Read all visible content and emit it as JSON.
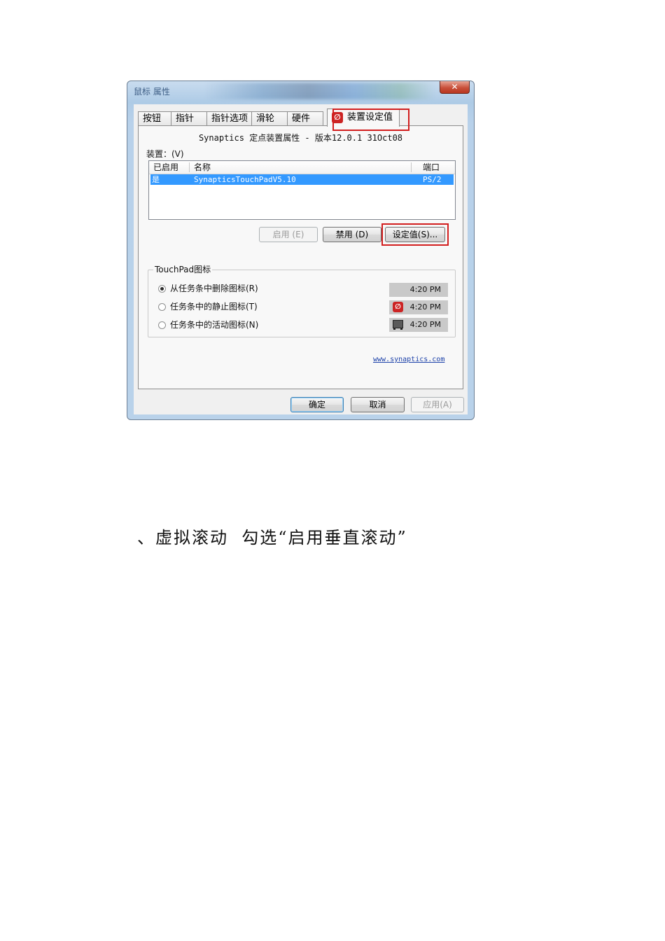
{
  "window": {
    "title": "鼠标 属性",
    "close_glyph": "✕"
  },
  "tabs": [
    "按钮",
    "指针",
    "指针选项",
    "滑轮",
    "硬件",
    "装置设定值"
  ],
  "tab_icon_glyph": "∅",
  "panel": {
    "version_text": "Synaptics 定点装置属性 - 版本12.0.1 31Oct08",
    "device_label": "装置：(V)",
    "columns": [
      "已启用",
      "名称",
      "端口"
    ],
    "rows": [
      {
        "enabled": "是",
        "name": "SynapticsTouchPadV5.10",
        "port": "PS/2"
      }
    ],
    "buttons": {
      "enable": "启用 (E)",
      "disable": "禁用 (D)",
      "settings": "设定值(S)..."
    },
    "group_title": "TouchPad图标",
    "radios": [
      {
        "label": "从任务条中删除图标(R)",
        "checked": true,
        "time": "4:20 PM",
        "icon": "none"
      },
      {
        "label": "任务条中的静止图标(T)",
        "checked": false,
        "time": "4:20 PM",
        "icon": "synaptics-icon"
      },
      {
        "label": "任务条中的活动图标(N)",
        "checked": false,
        "time": "4:20 PM",
        "icon": "touchpad-icon"
      }
    ],
    "link": "www.synaptics.com"
  },
  "footer": {
    "ok": "确定",
    "cancel": "取消",
    "apply": "应用(A)"
  },
  "doc_text": "、虚拟滚动  勾选“启用垂直滚动”",
  "colors": {
    "highlight_border": "#d21e1e",
    "selection": "#3399ff"
  }
}
